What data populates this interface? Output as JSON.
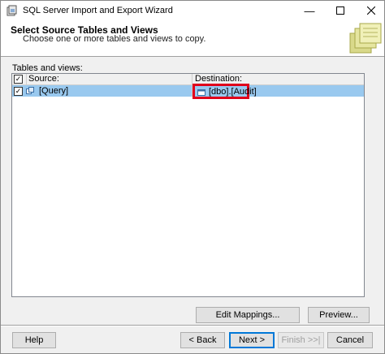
{
  "window": {
    "title": "SQL Server Import and Export Wizard"
  },
  "header": {
    "heading": "Select Source Tables and Views",
    "subheading": "Choose one or more tables and views to copy."
  },
  "tables": {
    "label": "Tables and views:",
    "columns": {
      "source": "Source:",
      "destination": "Destination:"
    },
    "rows": [
      {
        "checked": true,
        "source": "[Query]",
        "destination": "[dbo].[Audit]"
      }
    ]
  },
  "buttons": {
    "edit_mappings": "Edit Mappings...",
    "preview": "Preview...",
    "help": "Help",
    "back": "< Back",
    "next": "Next >",
    "finish": "Finish >>|",
    "cancel": "Cancel"
  },
  "colors": {
    "selected_row": "#99c9ef",
    "highlight_box": "#e0001b",
    "primary_border": "#0078d7"
  }
}
